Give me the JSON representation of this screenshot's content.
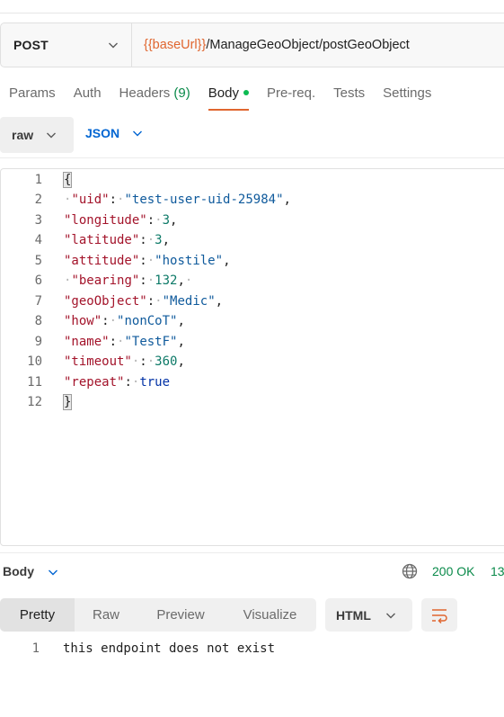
{
  "request": {
    "method": "POST",
    "url_variable": "{{baseUrl}}",
    "url_path": "/ManageGeoObject/postGeoObject"
  },
  "tabs": [
    {
      "label": "Params"
    },
    {
      "label": "Auth"
    },
    {
      "label": "Headers",
      "count": "(9)"
    },
    {
      "label": "Body",
      "active": true
    },
    {
      "label": "Pre-req."
    },
    {
      "label": "Tests"
    },
    {
      "label": "Settings"
    }
  ],
  "body_options": {
    "mode": "raw",
    "language": "JSON"
  },
  "editor": {
    "line_numbers": [
      "1",
      "2",
      "3",
      "4",
      "5",
      "6",
      "7",
      "8",
      "9",
      "10",
      "11",
      "12"
    ],
    "json": {
      "uid": "test-user-uid-25984",
      "longitude": "3",
      "latitude": "3",
      "attitude": "hostile",
      "bearing": "132",
      "geoObject": "Medic",
      "how": "nonCoT",
      "name": "TestF",
      "timeout": "360",
      "repeat": "true"
    },
    "open_brace": "{",
    "close_brace": "}"
  },
  "response": {
    "section_label": "Body",
    "status": "200 OK",
    "status_extra": "13",
    "view_tabs": [
      "Pretty",
      "Raw",
      "Preview",
      "Visualize"
    ],
    "active_view": "Pretty",
    "format": "HTML",
    "line_number": "1",
    "output": "this endpoint does not exist"
  },
  "colors": {
    "accent": "#e0662f",
    "status_ok": "#0a8a4a",
    "link_blue": "#0265d2",
    "json_key": "#a3132a",
    "json_string": "#0f5a9c",
    "json_number": "#0e7a68",
    "json_boolean": "#0232a6"
  },
  "icons": [
    "chevron-down-icon",
    "globe-icon",
    "wrap-lines-icon"
  ]
}
